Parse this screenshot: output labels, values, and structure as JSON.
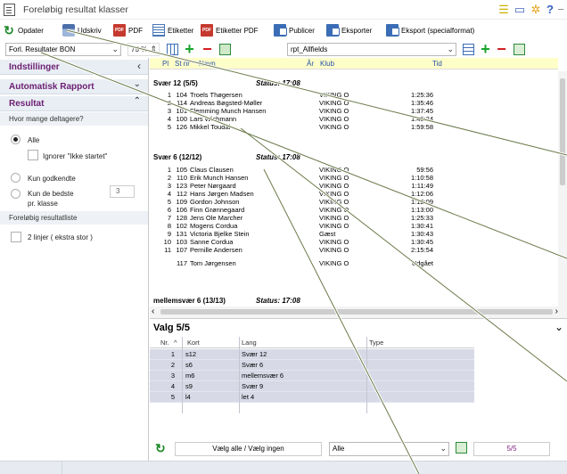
{
  "window": {
    "title": "Foreløbig resultat klasser"
  },
  "toolbar": {
    "update": "Opdater",
    "print": "Udskriv",
    "pdf": "PDF",
    "labels": "Etiketter",
    "labels_pdf": "Etiketter PDF",
    "publish": "Publicer",
    "export": "Eksporter",
    "export_special": "Eksport (specialformat)"
  },
  "toolbar2": {
    "report_select": "Forl. Resultater BON",
    "zoom": "75 %",
    "template_select": "rpt_Allfields"
  },
  "left_panel": {
    "settings": "Indstillinger",
    "auto_report": "Automatisk Rapport",
    "result": "Resultat",
    "question": "Hvor mange deltagere?",
    "opt_all": "Alle",
    "opt_ignore": "Ignorer \"Ikke startet\"",
    "opt_approved": "Kun godkendte",
    "opt_best_line1": "Kun de bedste",
    "opt_best_line2": "pr. klasse",
    "best_count": "3",
    "prelim_list": "Foreløbig resultatliste",
    "two_lines": "2 linjer ( ekstra stor )"
  },
  "report": {
    "columns": {
      "pl": "Pl",
      "startnr": "St nr",
      "name": "Navn",
      "year": "År",
      "club": "Klub",
      "time": "Tid"
    },
    "groups": [
      {
        "header": "Svær 12  (5/5)",
        "status": "Status: 17:08",
        "rows": [
          {
            "pl": "1",
            "nr": "104",
            "name": "Troels Thøgersen",
            "club": "VIKING O",
            "time": "1:25:36"
          },
          {
            "pl": "2",
            "nr": "114",
            "name": "Andreas Bøgsted-Møller",
            "club": "VIKING O",
            "time": "1:35:46"
          },
          {
            "pl": "3",
            "nr": "101",
            "name": "Flemming Munch Hansen",
            "club": "VIKING O",
            "time": "1:37:45"
          },
          {
            "pl": "4",
            "nr": "100",
            "name": "Lars Wichmann",
            "club": "VIKING O",
            "time": "1:45:24"
          },
          {
            "pl": "5",
            "nr": "126",
            "name": "Mikkel Toudal",
            "club": "VIKING O",
            "time": "1:59:58"
          }
        ]
      },
      {
        "header": "Svær 6  (12/12)",
        "status": "Status: 17:08",
        "rows": [
          {
            "pl": "1",
            "nr": "105",
            "name": "Claus Clausen",
            "club": "VIKING O",
            "time": "59:56"
          },
          {
            "pl": "2",
            "nr": "110",
            "name": "Erik Munch Hansen",
            "club": "VIKING O",
            "time": "1:10:58"
          },
          {
            "pl": "3",
            "nr": "123",
            "name": "Peter Nørgaard",
            "club": "VIKING O",
            "time": "1:11:49"
          },
          {
            "pl": "4",
            "nr": "112",
            "name": "Hans Jørgen Madsen",
            "club": "VIKING O",
            "time": "1:12:06"
          },
          {
            "pl": "5",
            "nr": "109",
            "name": "Gordon Johnson",
            "club": "VIKING O",
            "time": "1:12:09"
          },
          {
            "pl": "6",
            "nr": "106",
            "name": "Finn Grønnegaard",
            "club": "VIKING O",
            "time": "1:13:00"
          },
          {
            "pl": "7",
            "nr": "128",
            "name": "Jens Ole Marcher",
            "club": "VIKING O",
            "time": "1:25:33"
          },
          {
            "pl": "8",
            "nr": "102",
            "name": "Mogens Cordua",
            "club": "VIKING O",
            "time": "1:30:41"
          },
          {
            "pl": "9",
            "nr": "131",
            "name": "Victoria Bjelke Stein",
            "club": "Gæst",
            "time": "1:30:43"
          },
          {
            "pl": "10",
            "nr": "103",
            "name": "Sanne Cordua",
            "club": "VIKING O",
            "time": "1:30:45"
          },
          {
            "pl": "11",
            "nr": "107",
            "name": "Pernille Andersen",
            "club": "VIKING O",
            "time": "2:15:54"
          },
          {
            "pl": "",
            "nr": "117",
            "name": "Tom Jørgensen",
            "club": "VIKING O",
            "time": "Udgået"
          }
        ]
      },
      {
        "header": "mellemsvær 6  (13/13)",
        "status": "Status: 17:08",
        "rows": []
      }
    ]
  },
  "valg": {
    "title": "Valg 5/5",
    "columns": {
      "nr": "Nr.",
      "kort": "Kort",
      "lang": "Lang",
      "type": "Type"
    },
    "rows": [
      {
        "nr": "1",
        "kort": "s12",
        "lang": "Svær 12",
        "type": ""
      },
      {
        "nr": "2",
        "kort": "s6",
        "lang": "Svær 6",
        "type": ""
      },
      {
        "nr": "3",
        "kort": "m6",
        "lang": "mellemsvær 6",
        "type": ""
      },
      {
        "nr": "4",
        "kort": "s9",
        "lang": "Svær 9",
        "type": ""
      },
      {
        "nr": "5",
        "kort": "l4",
        "lang": "let 4",
        "type": ""
      }
    ],
    "select_all": "Vælg alle / Vælg ingen",
    "filter": "Alle",
    "count": "5/5"
  },
  "colors": {
    "section_header": "#6b1e73",
    "column_header_bg": "#fefec8",
    "selected_row_bg": "#d7d9e6"
  }
}
